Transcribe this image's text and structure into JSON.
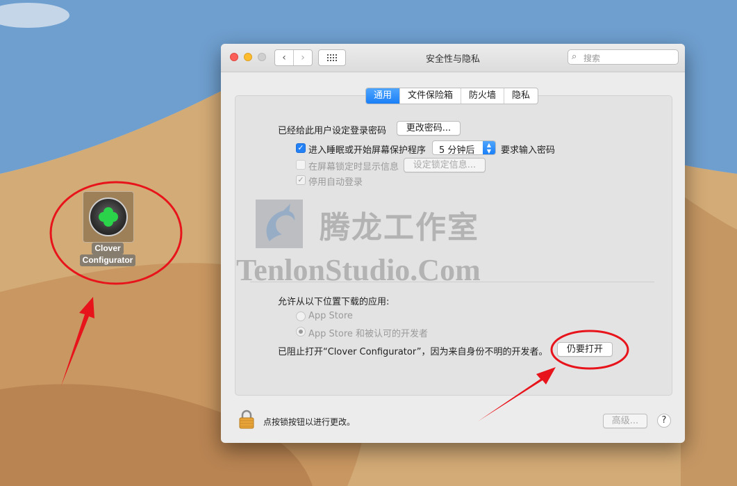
{
  "desktop": {
    "icon_label_line1": "Clover",
    "icon_label_line2": "Configurator"
  },
  "window": {
    "title": "安全性与隐私",
    "search_placeholder": "搜索",
    "tabs": [
      {
        "label": "通用",
        "active": true
      },
      {
        "label": "文件保险箱",
        "active": false
      },
      {
        "label": "防火墙",
        "active": false
      },
      {
        "label": "隐私",
        "active": false
      }
    ],
    "general": {
      "password_set_label": "已经给此用户设定登录密码",
      "change_password_button": "更改密码...",
      "require_password_label": "进入睡眠或开始屏幕保护程序",
      "require_password_checked": true,
      "require_password_delay": "5 分钟后",
      "require_password_suffix": "要求输入密码",
      "show_message_label": "在屏幕锁定时显示信息",
      "show_message_checked": false,
      "set_lock_message_button": "设定锁定信息...",
      "disable_autologin_label": "停用自动登录",
      "disable_autologin_checked": true,
      "allow_apps_label": "允许从以下位置下载的应用:",
      "option_app_store": "App Store",
      "option_app_store_devs": "App Store 和被认可的开发者",
      "selected_option": "App Store 和被认可的开发者",
      "blocked_message": "已阻止打开“Clover Configurator”，因为来自身份不明的开发者。",
      "open_anyway_button": "仍要打开"
    },
    "footer": {
      "lock_text": "点按锁按钮以进行更改。",
      "advanced_button": "高级...",
      "help_button": "?"
    },
    "watermark": {
      "chinese": "腾龙工作室",
      "english": "TenlonStudio.Com"
    }
  },
  "colors": {
    "accent": "#1a7ff7",
    "annotation_red": "#e8141b"
  }
}
